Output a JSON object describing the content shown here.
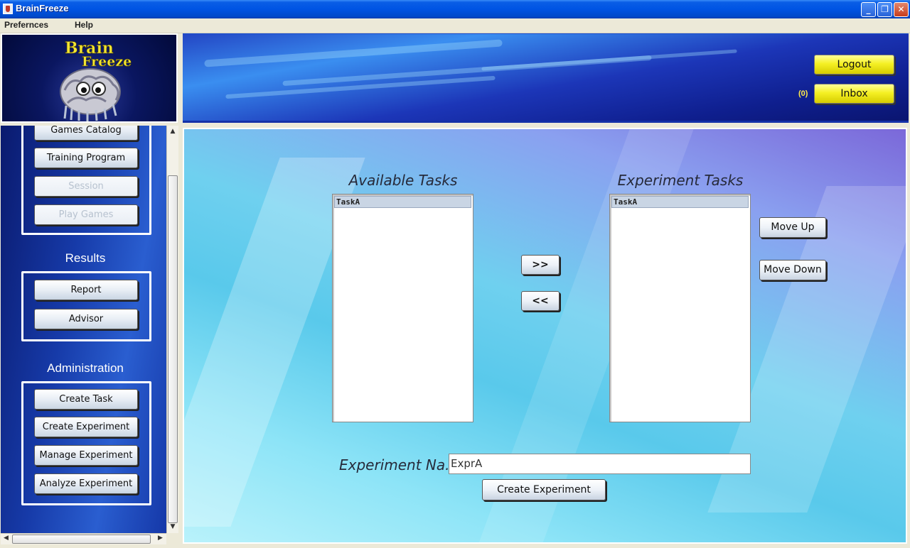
{
  "window": {
    "title": "BrainFreeze",
    "minimize": "_",
    "restore": "❐",
    "close": "✕"
  },
  "menu": {
    "items": [
      "Prefernces",
      "Help"
    ]
  },
  "header": {
    "logo_text_line1": "Brain",
    "logo_text_line2": "Freeze",
    "logout_label": "Logout",
    "inbox_label": "Inbox",
    "inbox_count": "(0)"
  },
  "sidebar": {
    "top_buttons": [
      {
        "label": "Games Catalog",
        "enabled": true
      },
      {
        "label": "Training Program",
        "enabled": true
      },
      {
        "label": "Session",
        "enabled": false
      },
      {
        "label": "Play Games",
        "enabled": false
      }
    ],
    "results": {
      "title": "Results",
      "buttons": [
        "Report",
        "Advisor"
      ]
    },
    "admin": {
      "title": "Administration",
      "buttons": [
        "Create Task",
        "Create Experiment",
        "Manage Experiment",
        "Analyze Experiment"
      ]
    },
    "scroll_up": "▲",
    "scroll_down": "▼",
    "scroll_left": "◀",
    "scroll_right": "▶"
  },
  "main": {
    "available": {
      "title": "Available Tasks",
      "items": [
        "TaskA"
      ]
    },
    "experiment": {
      "title": "Experiment Tasks",
      "items": [
        "TaskA"
      ]
    },
    "add_label": ">>",
    "remove_label": "<<",
    "move_up_label": "Move Up",
    "move_down_label": "Move Down",
    "name_label": "Experiment Na...",
    "name_value": "ExprA",
    "create_label": "Create Experiment"
  }
}
